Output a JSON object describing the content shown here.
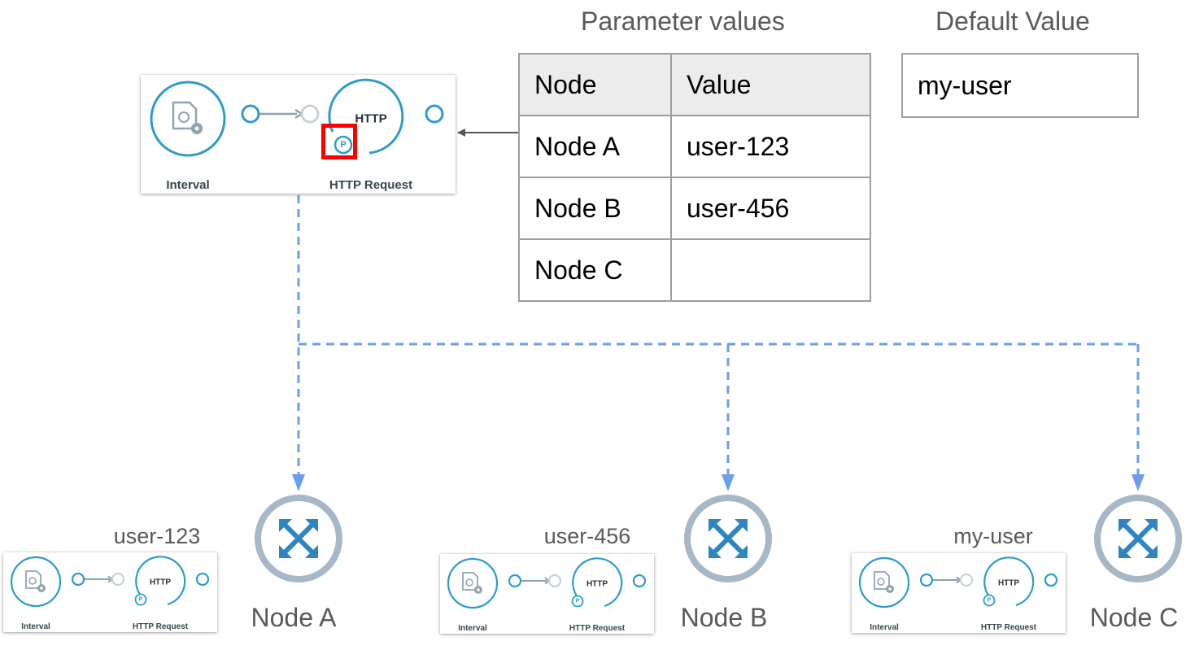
{
  "headings": {
    "parameter_values": "Parameter values",
    "default_value": "Default Value"
  },
  "table": {
    "columns": [
      "Node",
      "Value"
    ],
    "rows": [
      {
        "node": "Node A",
        "value": "user-123"
      },
      {
        "node": "Node B",
        "value": "user-456"
      },
      {
        "node": "Node C",
        "value": ""
      }
    ]
  },
  "default_value": "my-user",
  "flow": {
    "interval_label": "Interval",
    "http_label": "HTTP Request",
    "http_text": "HTTP",
    "param_badge": "P"
  },
  "nodes": [
    {
      "name": "Node A",
      "resolved_value": "user-123"
    },
    {
      "name": "Node B",
      "resolved_value": "user-456"
    },
    {
      "name": "Node C",
      "resolved_value": "my-user"
    }
  ],
  "colors": {
    "flow_accent": "#2e9cc8",
    "connector_dashed": "#6d9eeb",
    "node_ring": "#a7b7c6",
    "node_cross": "#2e86c1",
    "highlight": "#ff0000"
  },
  "icons": [
    "interval-settings-icon",
    "http-request-icon",
    "parameter-badge-icon",
    "cross-arrows-icon"
  ]
}
